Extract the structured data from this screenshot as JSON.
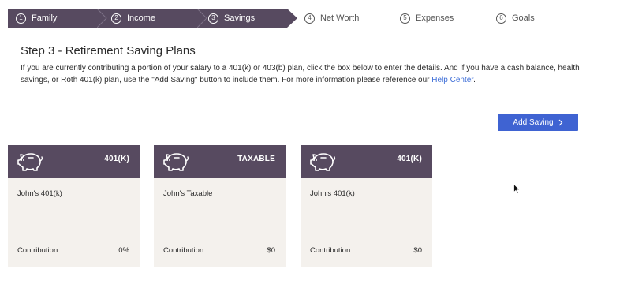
{
  "stepper": {
    "steps": [
      {
        "number": "1",
        "label": "Family",
        "state": "completed"
      },
      {
        "number": "2",
        "label": "Income",
        "state": "completed"
      },
      {
        "number": "3",
        "label": "Savings",
        "state": "current"
      },
      {
        "number": "4",
        "label": "Net Worth",
        "state": "upcoming"
      },
      {
        "number": "5",
        "label": "Expenses",
        "state": "upcoming"
      },
      {
        "number": "6",
        "label": "Goals",
        "state": "upcoming"
      }
    ]
  },
  "page": {
    "title": "Step 3 - Retirement Saving Plans",
    "description": "If you are currently contributing a portion of your salary to a 401(k) or 403(b) plan, click the box below to enter the details. And if you have a cash balance, health savings, or Roth 401(k) plan, use the \"Add Saving\" button to include them. For more information please reference our ",
    "help_link": "Help Center",
    "description_end": "."
  },
  "add_button": {
    "label": "Add Saving",
    "icon": "chevron-right-icon"
  },
  "cards": [
    {
      "type": "401(K)",
      "name": "John's 401(k)",
      "contribution_label": "Contribution",
      "contribution_value": "0%",
      "icon": "piggy-bank-icon"
    },
    {
      "type": "TAXABLE",
      "name": "John's Taxable",
      "contribution_label": "Contribution",
      "contribution_value": "$0",
      "icon": "piggy-bank-icon"
    },
    {
      "type": "401(K)",
      "name": "John's 401(k)",
      "contribution_label": "Contribution",
      "contribution_value": "$0",
      "icon": "piggy-bank-icon"
    }
  ],
  "colors": {
    "stepper_active": "#574a60",
    "card_header": "#574a60",
    "card_body": "#f4f1ed",
    "button": "#3f63d2",
    "link": "#3f6fd8"
  }
}
